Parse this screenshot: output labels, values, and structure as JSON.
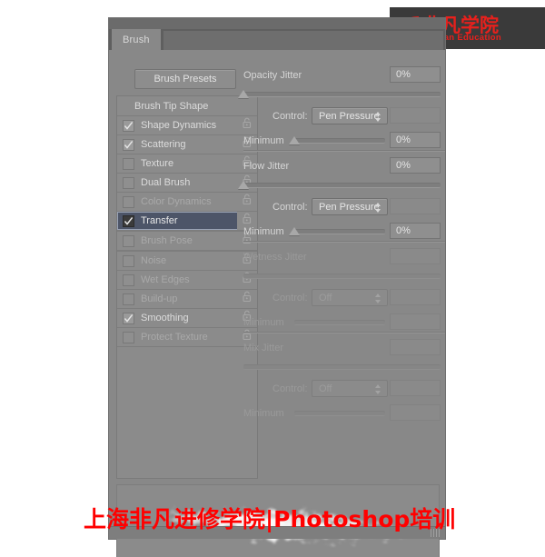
{
  "logo": {
    "icon": "leaf-icon",
    "cn_text": "非凡学院",
    "en_text": "FeiFan Education",
    "brand_color": "#e8201c"
  },
  "panel": {
    "tab_label": "Brush",
    "presets_button": "Brush Presets"
  },
  "options_list": {
    "header": "Brush Tip Shape",
    "items": [
      {
        "label": "Shape Dynamics",
        "checked": true,
        "selected": false,
        "dim": false,
        "lock": "unlock-icon"
      },
      {
        "label": "Scattering",
        "checked": true,
        "selected": false,
        "dim": false,
        "lock": "unlock-icon"
      },
      {
        "label": "Texture",
        "checked": false,
        "selected": false,
        "dim": false,
        "lock": "unlock-icon"
      },
      {
        "label": "Dual Brush",
        "checked": false,
        "selected": false,
        "dim": false,
        "lock": "unlock-icon"
      },
      {
        "label": "Color Dynamics",
        "checked": false,
        "selected": false,
        "dim": true,
        "lock": "unlock-icon"
      },
      {
        "label": "Transfer",
        "checked": true,
        "selected": true,
        "dim": false,
        "lock": "unlock-icon"
      },
      {
        "label": "Brush Pose",
        "checked": false,
        "selected": false,
        "dim": true,
        "lock": "unlock-icon"
      },
      {
        "label": "Noise",
        "checked": false,
        "selected": false,
        "dim": true,
        "lock": "unlock-icon"
      },
      {
        "label": "Wet Edges",
        "checked": false,
        "selected": false,
        "dim": true,
        "lock": "unlock-icon"
      },
      {
        "label": "Build-up",
        "checked": false,
        "selected": false,
        "dim": true,
        "lock": "unlock-icon"
      },
      {
        "label": "Smoothing",
        "checked": true,
        "selected": false,
        "dim": false,
        "lock": "unlock-icon"
      },
      {
        "label": "Protect Texture",
        "checked": false,
        "selected": false,
        "dim": true,
        "lock": "unlock-icon"
      }
    ]
  },
  "transfer_settings": {
    "groups": [
      {
        "title": "Opacity Jitter",
        "value": "0%",
        "slider_percent": 0,
        "enabled": true,
        "control_label": "Control:",
        "control_value": "Pen Pressure",
        "control_extra_value": "",
        "minimum_label": "Minimum",
        "minimum_value": "0%",
        "minimum_percent": 0
      },
      {
        "title": "Flow Jitter",
        "value": "0%",
        "slider_percent": 0,
        "enabled": true,
        "control_label": "Control:",
        "control_value": "Pen Pressure",
        "control_extra_value": "",
        "minimum_label": "Minimum",
        "minimum_value": "0%",
        "minimum_percent": 0
      },
      {
        "title": "Wetness Jitter",
        "value": "",
        "slider_percent": 0,
        "enabled": false,
        "control_label": "Control:",
        "control_value": "Off",
        "control_extra_value": "",
        "minimum_label": "Minimum",
        "minimum_value": "",
        "minimum_percent": 0
      },
      {
        "title": "Mix Jitter",
        "value": "",
        "slider_percent": 0,
        "enabled": false,
        "control_label": "Control:",
        "control_value": "Off",
        "control_extra_value": "",
        "minimum_label": "Minimum",
        "minimum_value": "",
        "minimum_percent": 0
      }
    ]
  },
  "preview": {
    "name": "brush-stroke-preview"
  },
  "watermark": {
    "text": "上海非凡进修学院|Photoshop培训",
    "color": "#ff0000"
  }
}
